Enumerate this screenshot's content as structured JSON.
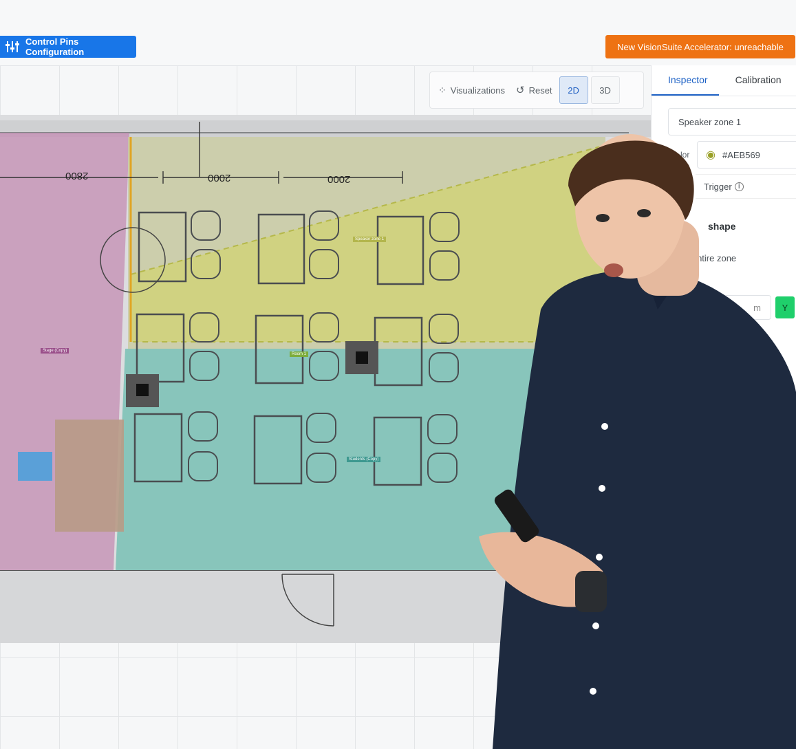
{
  "toolbar_top": {
    "pins_label": "Control Pins Configuration",
    "warning_label": "New VisionSuite Accelerator: unreachable"
  },
  "view_toolbar": {
    "visualizations_label": "Visualizations",
    "reset_label": "Reset",
    "mode_2d": "2D",
    "mode_3d": "3D",
    "active_mode": "2D"
  },
  "inspector": {
    "tabs": [
      {
        "label": "Inspector",
        "active": true
      },
      {
        "label": "Calibration",
        "active": false
      }
    ],
    "zone_name": "Speaker zone 1",
    "color_label": "lor",
    "color_value": "#AEB569",
    "trigger_label": "Trigger",
    "shape_label": "shape",
    "entire_zone_label": "e entire zone",
    "unit_label": "m",
    "axis_button": "Y"
  },
  "floorplan": {
    "dimensions": [
      "2800",
      "2000",
      "2000"
    ],
    "zones": [
      {
        "label": "Stage (Copy)",
        "color": "#b36a9c"
      },
      {
        "label": "Speaker zone 1",
        "color": "#aeb569"
      },
      {
        "label": "Room 1",
        "color": "#8cb84e"
      },
      {
        "label": "Students (Copy)",
        "color": "#4fa8a0"
      }
    ]
  },
  "colors": {
    "accent_blue": "#1876e8",
    "warning_orange": "#ee7213",
    "axis_green": "#1fcf6b"
  }
}
